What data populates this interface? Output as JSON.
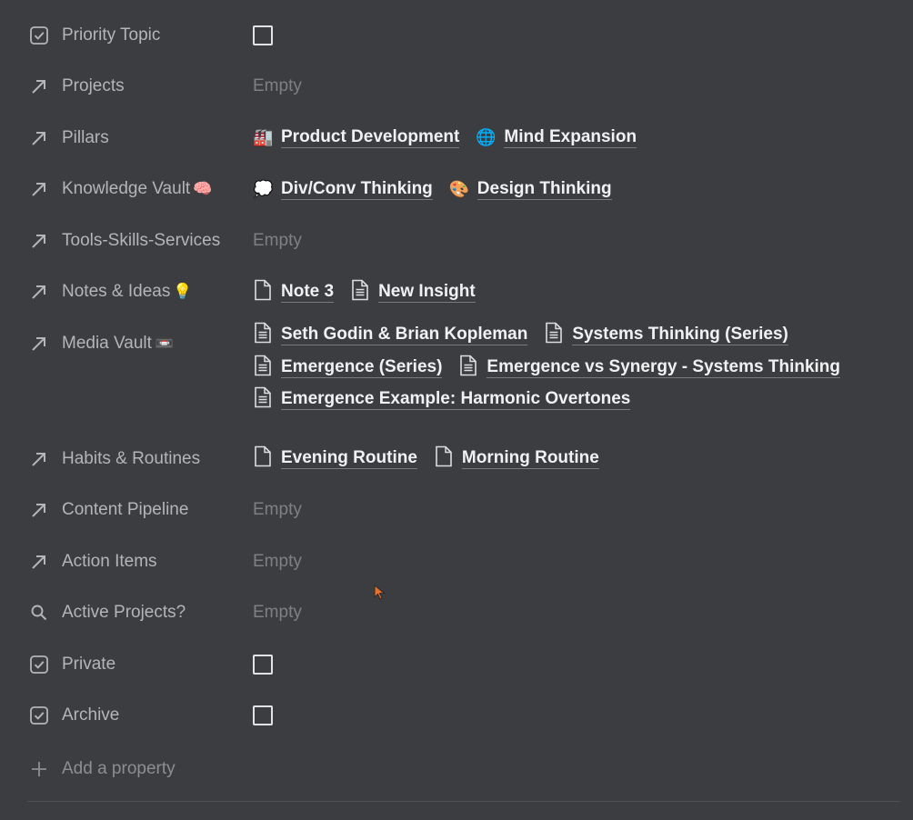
{
  "properties": [
    {
      "name": "Priority Topic",
      "icon": "checkbox-icon",
      "type": "checkbox",
      "checked": false
    },
    {
      "name": "Projects",
      "icon": "relation-arrow-icon",
      "type": "relation",
      "empty_label": "Empty"
    },
    {
      "name": "Pillars",
      "icon": "relation-arrow-icon",
      "type": "relation",
      "items": [
        {
          "icon": "factory-emoji",
          "glyph": "🏭",
          "label": "Product Development"
        },
        {
          "icon": "globe-emoji",
          "glyph": "🌐",
          "label": "Mind Expansion"
        }
      ]
    },
    {
      "name": "Knowledge Vault",
      "emoji": "🧠",
      "icon": "relation-arrow-icon",
      "type": "relation",
      "items": [
        {
          "icon": "thought-bubble-emoji",
          "glyph": "💭",
          "label": "Div/Conv Thinking"
        },
        {
          "icon": "palette-emoji",
          "glyph": "🎨",
          "label": "Design Thinking"
        }
      ]
    },
    {
      "name": "Tools-Skills-Services",
      "icon": "relation-arrow-icon",
      "type": "relation",
      "empty_label": "Empty"
    },
    {
      "name": "Notes & Ideas",
      "emoji": "💡",
      "icon": "relation-arrow-icon",
      "type": "relation",
      "items": [
        {
          "icon": "page-icon",
          "label": "Note 3"
        },
        {
          "icon": "document-icon",
          "label": "New Insight"
        }
      ]
    },
    {
      "name": "Media Vault",
      "emoji": "📼",
      "icon": "relation-arrow-icon",
      "type": "relation",
      "items": [
        {
          "icon": "document-icon",
          "label": "Seth Godin & Brian Kopleman"
        },
        {
          "icon": "document-icon",
          "label": "Systems Thinking (Series)"
        },
        {
          "icon": "document-icon",
          "label": "Emergence (Series)"
        },
        {
          "icon": "document-icon",
          "label": "Emergence vs Synergy - Systems Thinking"
        },
        {
          "icon": "document-icon",
          "label": "Emergence Example: Harmonic Overtones"
        }
      ]
    },
    {
      "name": "Habits & Routines",
      "icon": "relation-arrow-icon",
      "type": "relation",
      "items": [
        {
          "icon": "page-icon",
          "label": "Evening Routine"
        },
        {
          "icon": "page-icon",
          "label": "Morning Routine"
        }
      ]
    },
    {
      "name": "Content Pipeline",
      "icon": "relation-arrow-icon",
      "type": "relation",
      "empty_label": "Empty"
    },
    {
      "name": "Action Items",
      "icon": "relation-arrow-icon",
      "type": "relation",
      "empty_label": "Empty"
    },
    {
      "name": "Active Projects?",
      "icon": "search-icon",
      "type": "rollup",
      "empty_label": "Empty"
    },
    {
      "name": "Private",
      "icon": "checkbox-icon",
      "type": "checkbox",
      "checked": false
    },
    {
      "name": "Archive",
      "icon": "checkbox-icon",
      "type": "checkbox",
      "checked": false
    }
  ],
  "add_property": {
    "label": "Add a property",
    "icon": "plus-icon"
  },
  "colors": {
    "background": "#3b3d40",
    "label": "#b3b5b8",
    "value": "#f0f1f2",
    "empty": "#7e8084",
    "cursor": "#e8702a"
  }
}
